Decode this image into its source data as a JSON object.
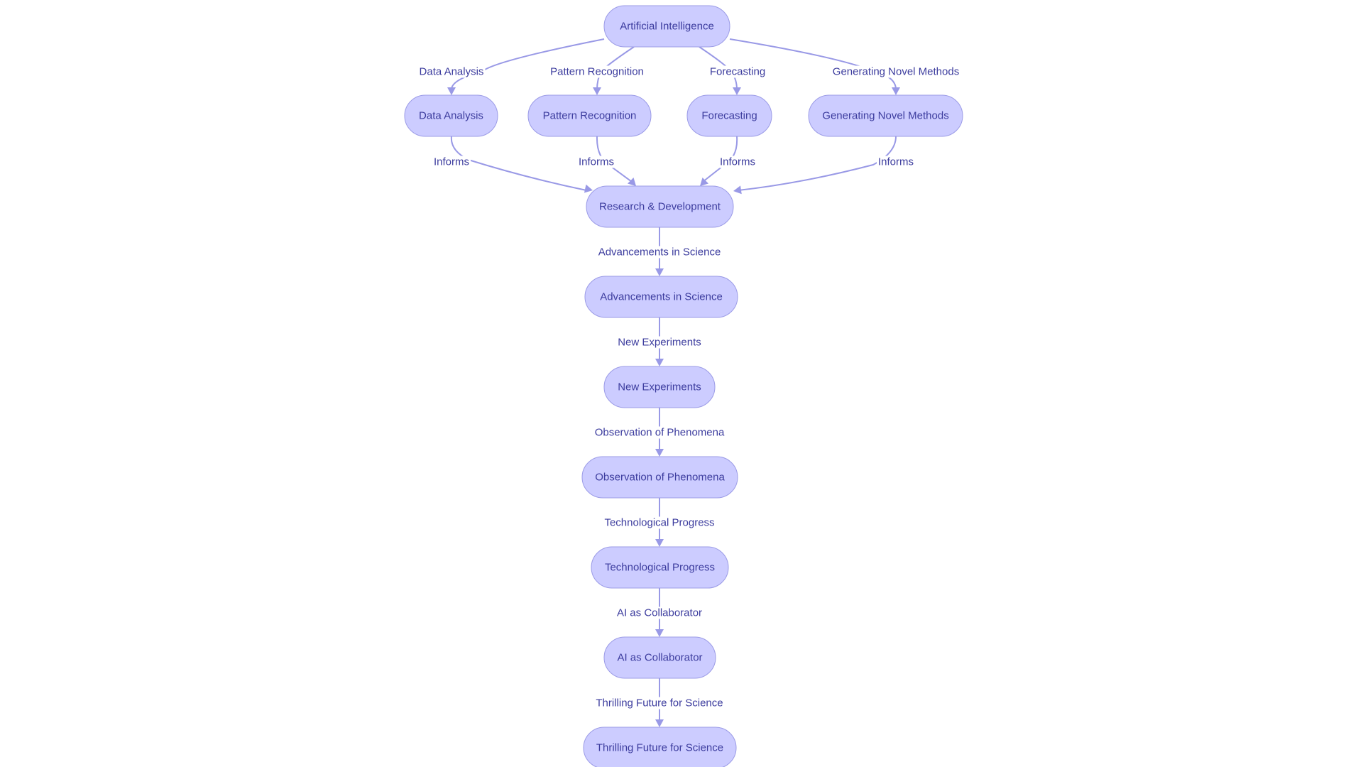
{
  "diagram": {
    "type": "flowchart",
    "direction": "top-down",
    "colors": {
      "node_fill": "#ccccff",
      "node_stroke": "#9b9be6",
      "edge": "#9999e6",
      "text": "#3c3c9e",
      "background": "#ffffff"
    },
    "nodes": [
      {
        "id": "ai",
        "label": "Artificial Intelligence"
      },
      {
        "id": "da",
        "label": "Data Analysis"
      },
      {
        "id": "pr",
        "label": "Pattern Recognition"
      },
      {
        "id": "fc",
        "label": "Forecasting"
      },
      {
        "id": "gnm",
        "label": "Generating Novel Methods"
      },
      {
        "id": "rd",
        "label": "Research & Development"
      },
      {
        "id": "as",
        "label": "Advancements in Science"
      },
      {
        "id": "ne",
        "label": "New Experiments"
      },
      {
        "id": "op",
        "label": "Observation of Phenomena"
      },
      {
        "id": "tp",
        "label": "Technological Progress"
      },
      {
        "id": "aic",
        "label": "AI as Collaborator"
      },
      {
        "id": "tfs",
        "label": "Thrilling Future for Science"
      }
    ],
    "edges": [
      {
        "from": "ai",
        "to": "da",
        "label": "Data Analysis"
      },
      {
        "from": "ai",
        "to": "pr",
        "label": "Pattern Recognition"
      },
      {
        "from": "ai",
        "to": "fc",
        "label": "Forecasting"
      },
      {
        "from": "ai",
        "to": "gnm",
        "label": "Generating Novel Methods"
      },
      {
        "from": "da",
        "to": "rd",
        "label": "Informs"
      },
      {
        "from": "pr",
        "to": "rd",
        "label": "Informs"
      },
      {
        "from": "fc",
        "to": "rd",
        "label": "Informs"
      },
      {
        "from": "gnm",
        "to": "rd",
        "label": "Informs"
      },
      {
        "from": "rd",
        "to": "as",
        "label": "Advancements in Science"
      },
      {
        "from": "as",
        "to": "ne",
        "label": "New Experiments"
      },
      {
        "from": "ne",
        "to": "op",
        "label": "Observation of Phenomena"
      },
      {
        "from": "op",
        "to": "tp",
        "label": "Technological Progress"
      },
      {
        "from": "tp",
        "to": "aic",
        "label": "AI as Collaborator"
      },
      {
        "from": "aic",
        "to": "tfs",
        "label": "Thrilling Future for Science"
      }
    ]
  }
}
